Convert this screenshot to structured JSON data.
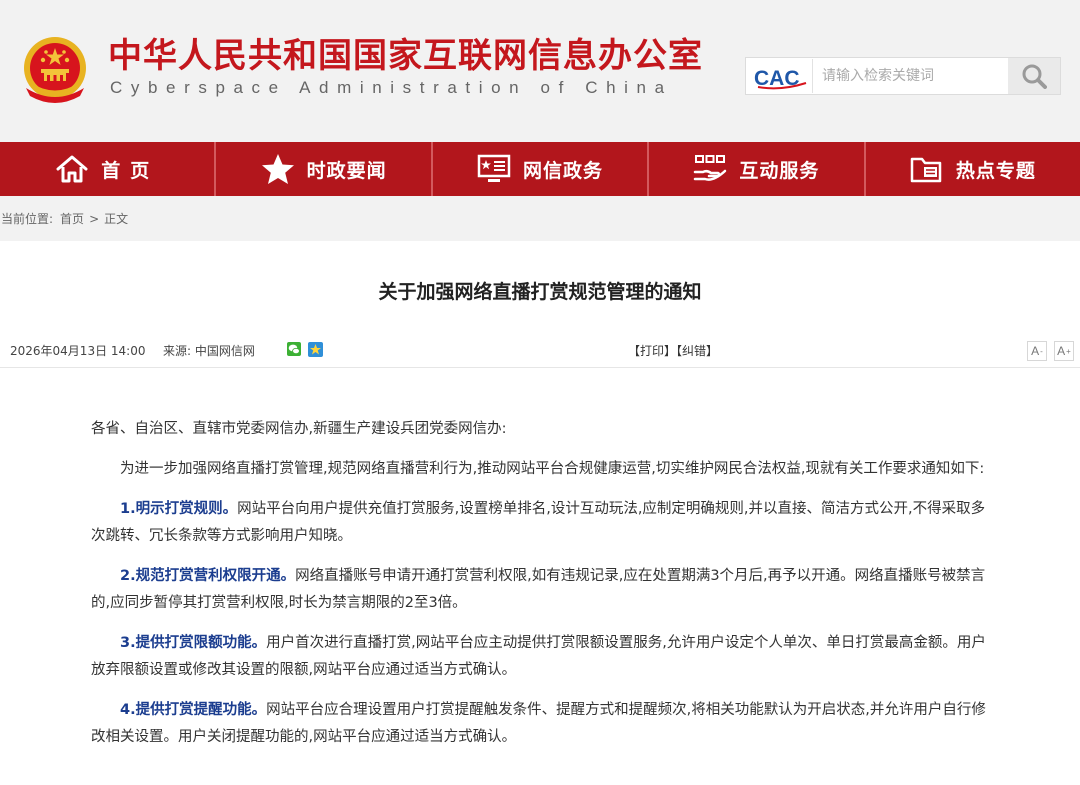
{
  "header": {
    "site_title": "中华人民共和国国家互联网信息办公室",
    "site_subtitle": "Cyberspace Administration of China",
    "search_logo_text": "CAC",
    "search_placeholder": "请输入检索关键词"
  },
  "nav": {
    "items": [
      {
        "label": "首页",
        "icon": "home-icon"
      },
      {
        "label": "时政要闻",
        "icon": "star-icon"
      },
      {
        "label": "网信政务",
        "icon": "monitor-icon"
      },
      {
        "label": "互动服务",
        "icon": "hand-service-icon"
      },
      {
        "label": "热点专题",
        "icon": "folder-icon"
      }
    ]
  },
  "breadcrumb": {
    "lead": "当前位置:",
    "home": "首页",
    "separator": ">",
    "current": "正文"
  },
  "article": {
    "title": "关于加强网络直播打赏规范管理的通知",
    "datetime": "2026年04月13日 14:00",
    "source": "来源: 中国网信网",
    "print_label": "【打印】",
    "correct_label": "【纠错】",
    "font_small": "A",
    "font_small_sup": "-",
    "font_large": "A",
    "font_large_sup": "+",
    "salutation": "各省、自治区、直辖市党委网信办,新疆生产建设兵团党委网信办:",
    "intro": "为进一步加强网络直播打赏管理,规范网络直播营利行为,推动网站平台合规健康运营,切实维护网民合法权益,现就有关工作要求通知如下:",
    "items": [
      {
        "heading": "1.明示打赏规则。",
        "text": "网站平台向用户提供充值打赏服务,设置榜单排名,设计互动玩法,应制定明确规则,并以直接、简洁方式公开,不得采取多次跳转、冗长条款等方式影响用户知晓。"
      },
      {
        "heading": "2.规范打赏营利权限开通。",
        "text": "网络直播账号申请开通打赏营利权限,如有违规记录,应在处置期满3个月后,再予以开通。网络直播账号被禁言的,应同步暂停其打赏营利权限,时长为禁言期限的2至3倍。"
      },
      {
        "heading": "3.提供打赏限额功能。",
        "text": "用户首次进行直播打赏,网站平台应主动提供打赏限额设置服务,允许用户设定个人单次、单日打赏最高金额。用户放弃限额设置或修改其设置的限额,网站平台应通过适当方式确认。"
      },
      {
        "heading": "4.提供打赏提醒功能。",
        "text": "网站平台应合理设置用户打赏提醒触发条件、提醒方式和提醒频次,将相关功能默认为开启状态,并允许用户自行修改相关设置。用户关闭提醒功能的,网站平台应通过适当方式确认。"
      }
    ]
  },
  "colors": {
    "brand_red": "#c4171d",
    "nav_red": "#b2161c",
    "heading_blue": "#1b3d8f",
    "header_bg": "#f2f2f2"
  }
}
